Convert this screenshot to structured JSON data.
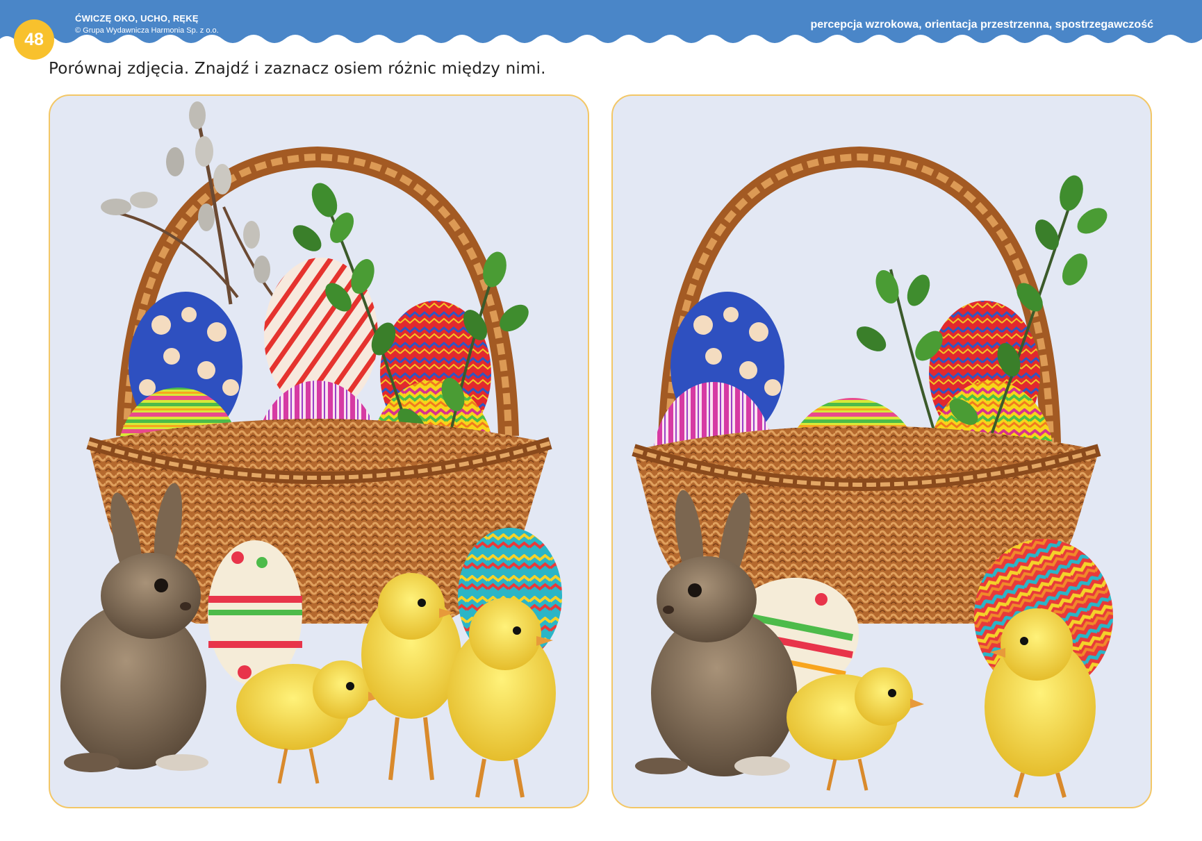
{
  "header": {
    "page_number": "48",
    "book_title": "ĆWICZĘ OKO, UCHO, RĘKĘ",
    "copyright": "© Grupa Wydawnicza Harmonia Sp. z o.o.",
    "skills": "percepcja wzrokowa, orientacja przestrzenna, spostrzegawczość"
  },
  "instruction": "Porównaj zdjęcia. Znajdź i zaznacz osiem różnic między nimi.",
  "colors": {
    "header_blue": "#4a86c8",
    "badge_yellow": "#f8c12d",
    "panel_bg": "#e3e8f4",
    "panel_border": "#f3c766"
  },
  "panels": [
    {
      "name": "left-picture",
      "contains": [
        "basket-icon",
        "willow-catkins-icon",
        "boxwood-sprig-icon",
        "easter-eggs-icon",
        "rabbit-icon",
        "chick-icon",
        "chick-icon",
        "chick-icon"
      ]
    },
    {
      "name": "right-picture",
      "contains": [
        "basket-icon",
        "boxwood-sprig-icon",
        "easter-eggs-icon",
        "rabbit-icon",
        "chick-icon",
        "chick-icon"
      ]
    }
  ]
}
